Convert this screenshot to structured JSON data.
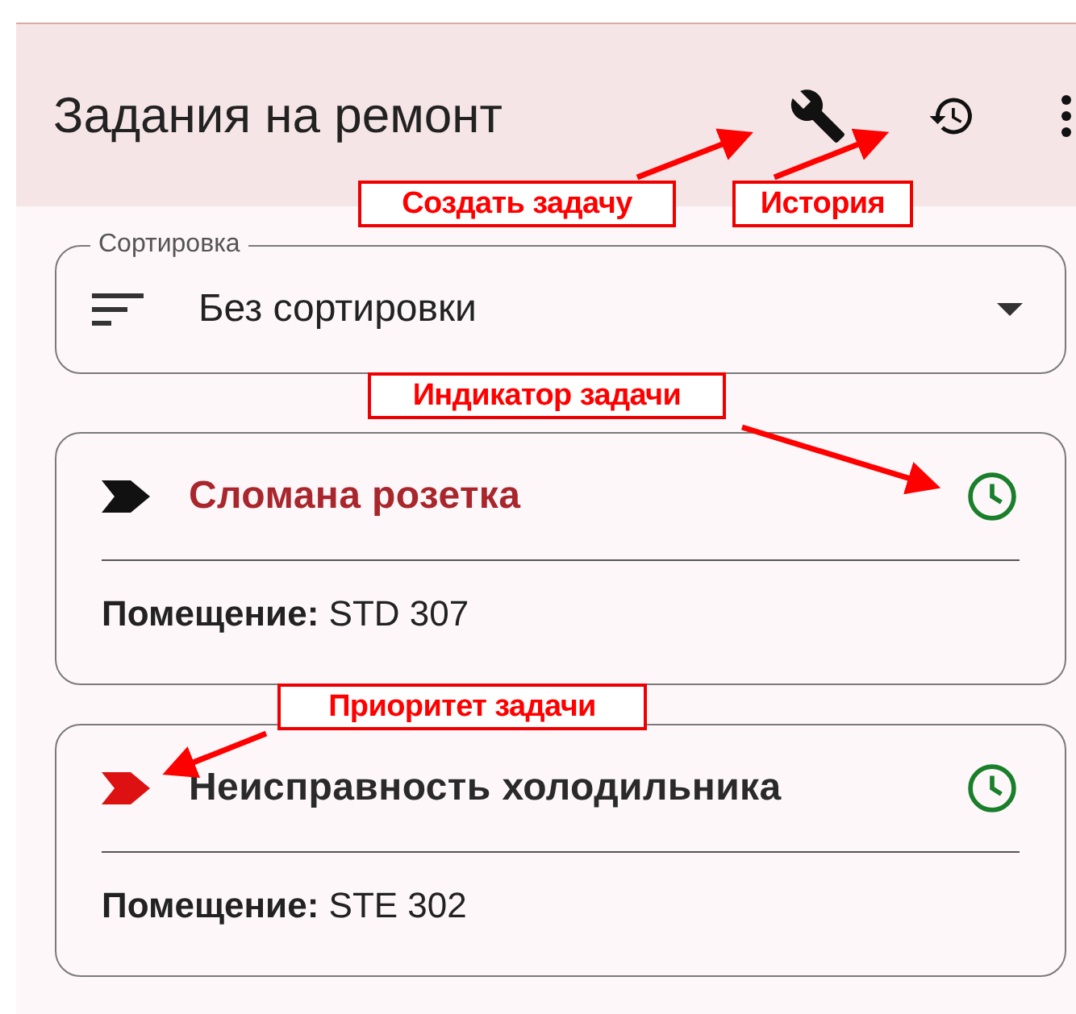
{
  "app_bar": {
    "title": "Задания на ремонт"
  },
  "sort": {
    "label": "Сортировка",
    "value": "Без сортировки"
  },
  "tasks": [
    {
      "title": "Сломана розетка",
      "title_highlighted": true,
      "color": "#111111",
      "room": "**Помещение:** STD 307"
    },
    {
      "title": "Неисправность холодильника",
      "title_highlighted": false,
      "color": "#dd1111",
      "room": "**Помещение:** STE 302"
    }
  ],
  "annotations": [
    {
      "text": "Создать задачу"
    },
    {
      "text": "История"
    },
    {
      "text": "Индикатор задачи"
    },
    {
      "text": "Приоритет задачи"
    }
  ]
}
